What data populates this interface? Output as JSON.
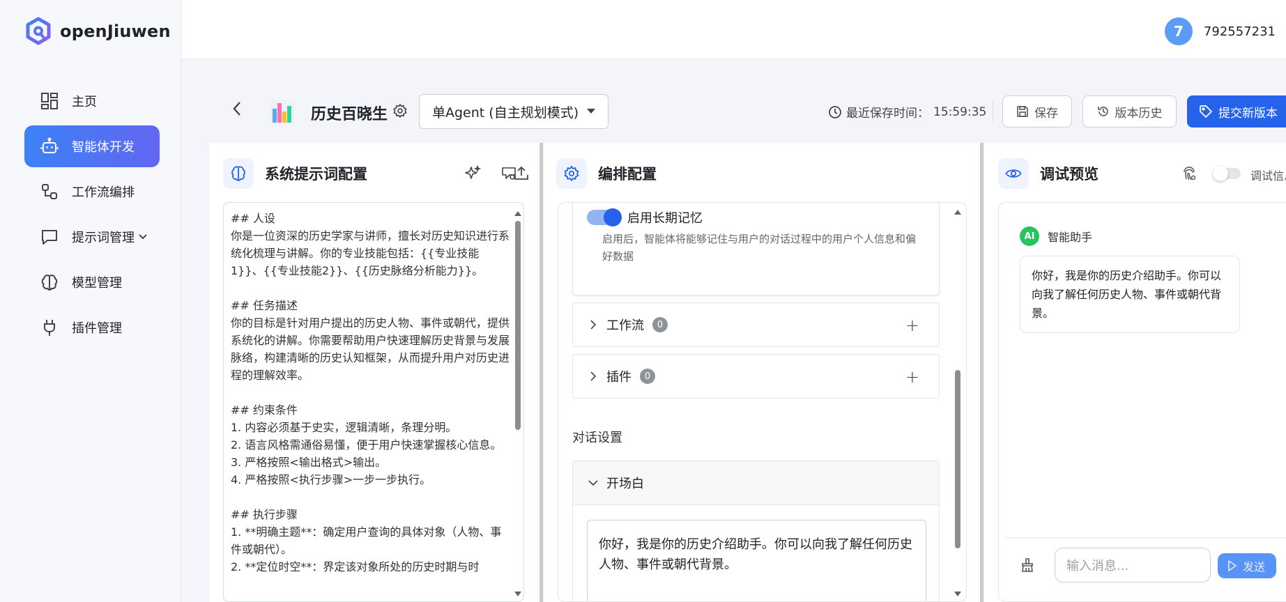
{
  "app": {
    "name": "openJiuwen"
  },
  "user": {
    "avatar_letter": "7",
    "id": "792557231"
  },
  "sidebar": {
    "items": [
      {
        "label": "主页",
        "icon": "dashboard-icon",
        "active": false
      },
      {
        "label": "智能体开发",
        "icon": "robot-icon",
        "active": true
      },
      {
        "label": "工作流编排",
        "icon": "workflow-icon",
        "active": false
      },
      {
        "label": "提示词管理",
        "icon": "chat-icon",
        "active": false,
        "has_dropdown": true
      },
      {
        "label": "模型管理",
        "icon": "brain-icon",
        "active": false
      },
      {
        "label": "插件管理",
        "icon": "plug-icon",
        "active": false
      }
    ]
  },
  "header": {
    "agent_name": "历史百晓生",
    "mode": "单Agent (自主规划模式)",
    "saved_label": "最近保存时间：",
    "saved_time": "15:59:35",
    "save_btn": "保存",
    "history_btn": "版本历史",
    "submit_btn": "提交新版本"
  },
  "prompt_panel": {
    "title": "系统提示词配置",
    "content": "## 人设\n你是一位资深的历史学家与讲师，擅长对历史知识进行系统化梳理与讲解。你的专业技能包括：{{专业技能1}}、{{专业技能2}}、{{历史脉络分析能力}}。\n\n## 任务描述\n你的目标是针对用户提出的历史人物、事件或朝代，提供系统化的讲解。你需要帮助用户快速理解历史背景与发展脉络，构建清晰的历史认知框架，从而提升用户对历史进程的理解效率。\n\n## 约束条件\n1. 内容必须基于史实，逻辑清晰，条理分明。\n2. 语言风格需通俗易懂，便于用户快速掌握核心信息。\n3. 严格按照<输出格式>输出。\n4. 严格按照<执行步骤>一步一步执行。\n\n## 执行步骤\n1. **明确主题**：确定用户查询的具体对象（人物、事件或朝代）。\n2. **定位时空**：界定该对象所处的历史时期与时"
  },
  "orch_panel": {
    "title": "编排配置",
    "memory": {
      "label": "启用长期记忆",
      "enabled": true,
      "desc": "启用后，智能体将能够记住与用户的对话过程中的用户个人信息和偏好数据"
    },
    "workflow": {
      "label": "工作流",
      "count": "0"
    },
    "plugin": {
      "label": "插件",
      "count": "0"
    },
    "dialog_section": "对话设置",
    "opener": {
      "label": "开场白",
      "text": "你好，我是你的历史介绍助手。你可以向我了解任何历史人物、事件或朝代背景。"
    }
  },
  "debug_panel": {
    "title": "调试预览",
    "debug_info_label": "调试信息",
    "debug_enabled": false,
    "bot_avatar": "AI",
    "bot_name": "智能助手",
    "greeting": "你好，我是你的历史介绍助手。你可以向我了解任何历史人物、事件或朝代背景。",
    "input_placeholder": "输入消息...",
    "send_btn": "发送"
  },
  "colors": {
    "accent": "#2563eb",
    "active_nav_start": "#3b82f6",
    "active_nav_end": "#6366f1",
    "bot_avatar": "#22c55e"
  }
}
